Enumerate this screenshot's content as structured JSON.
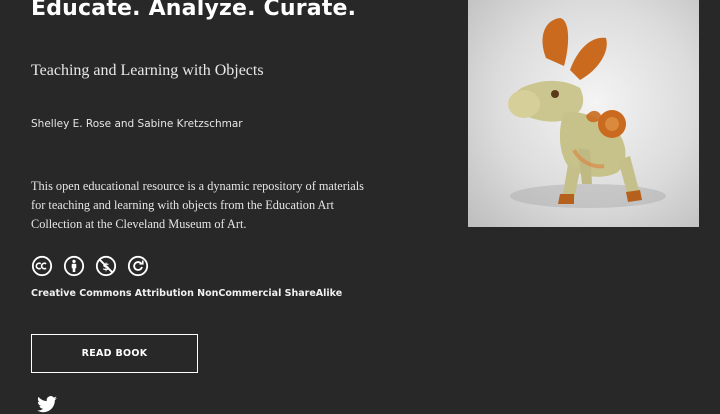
{
  "book": {
    "title": "Educate. Analyze. Curate.",
    "subtitle": "Teaching and Learning with Objects",
    "authors": "Shelley E. Rose and Sabine Kretzschmar",
    "description": "This open educational resource is a dynamic repository of materials for teaching and learning with objects from the Education Art Collection at the Cleveland Museum of Art.",
    "license_label": "Creative Commons Attribution NonCommercial ShareAlike",
    "read_button": "READ BOOK"
  },
  "icons": {
    "license": [
      "cc-icon",
      "by-icon",
      "nc-icon",
      "sa-icon"
    ],
    "social": "twitter-icon"
  },
  "colors": {
    "background": "#282828",
    "text": "#ffffff",
    "figure_green": "#c8c48a",
    "figure_orange": "#c96a1e"
  }
}
